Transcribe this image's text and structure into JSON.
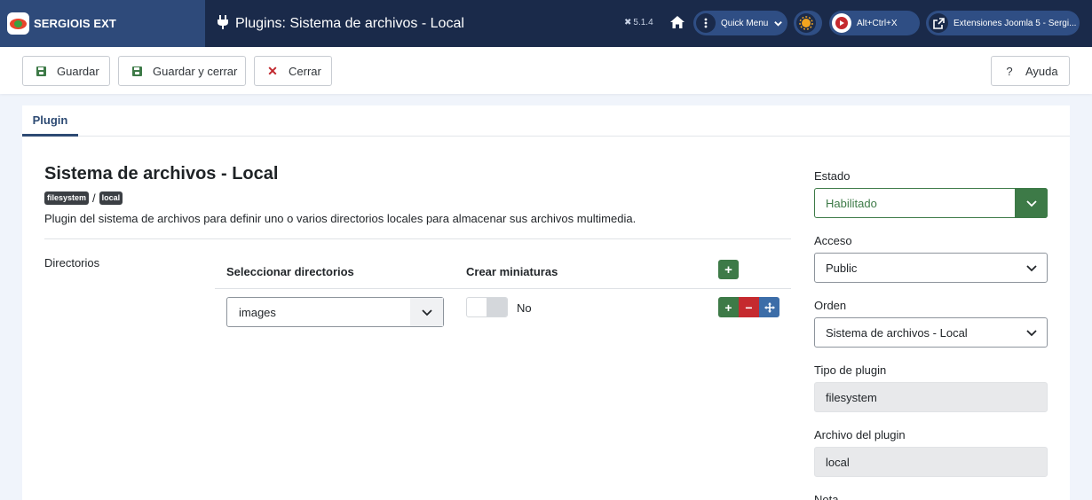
{
  "header": {
    "brand": "SERGIOIS EXT",
    "title": "Plugins: Sistema de archivos - Local",
    "version": "5.1.4",
    "quick_menu": "Quick Menu",
    "shortcut": "Alt+Ctrl+X",
    "site_link": "Extensiones Joomla 5 - Sergi..."
  },
  "toolbar": {
    "save": "Guardar",
    "save_close": "Guardar y cerrar",
    "close": "Cerrar",
    "help": "Ayuda"
  },
  "tabs": [
    {
      "label": "Plugin"
    }
  ],
  "plugin": {
    "title": "Sistema de archivos - Local",
    "badge_group": "filesystem",
    "separator": "/",
    "badge_element": "local",
    "description": "Plugin del sistema de archivos para definir uno o varios directorios locales para almacenar sus archivos multimedia."
  },
  "directories": {
    "label": "Directorios",
    "col_select": "Seleccionar directorios",
    "col_thumbs": "Crear miniaturas",
    "rows": [
      {
        "directory": "images",
        "thumbnails": "No"
      }
    ]
  },
  "sidebar": {
    "estado_label": "Estado",
    "estado_value": "Habilitado",
    "acceso_label": "Acceso",
    "acceso_value": "Public",
    "orden_label": "Orden",
    "orden_value": "Sistema de archivos - Local",
    "tipo_label": "Tipo de plugin",
    "tipo_value": "filesystem",
    "archivo_label": "Archivo del plugin",
    "archivo_value": "local",
    "nota_label": "Nota"
  },
  "colors": {
    "header_bg": "#1a2a4a",
    "brand_bg": "#2e4a7a",
    "success": "#3d7a47",
    "danger": "#c52a2f",
    "primary": "#2d4a73"
  },
  "icons": [
    "joomla-icon",
    "plug-icon",
    "home-icon",
    "kebab-icon",
    "chevron-down-icon",
    "sun-icon",
    "play-icon",
    "external-link-icon",
    "save-icon",
    "close-icon",
    "question-icon",
    "plus-icon",
    "minus-icon",
    "move-icon"
  ]
}
